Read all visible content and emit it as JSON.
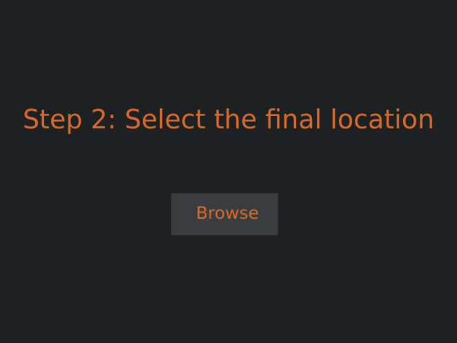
{
  "step": {
    "title": "Step 2: Select the final location"
  },
  "actions": {
    "browse_label": "Browse"
  },
  "colors": {
    "background": "#1d2121",
    "accent_text": "#d96a2b",
    "button_background": "#393d40"
  }
}
